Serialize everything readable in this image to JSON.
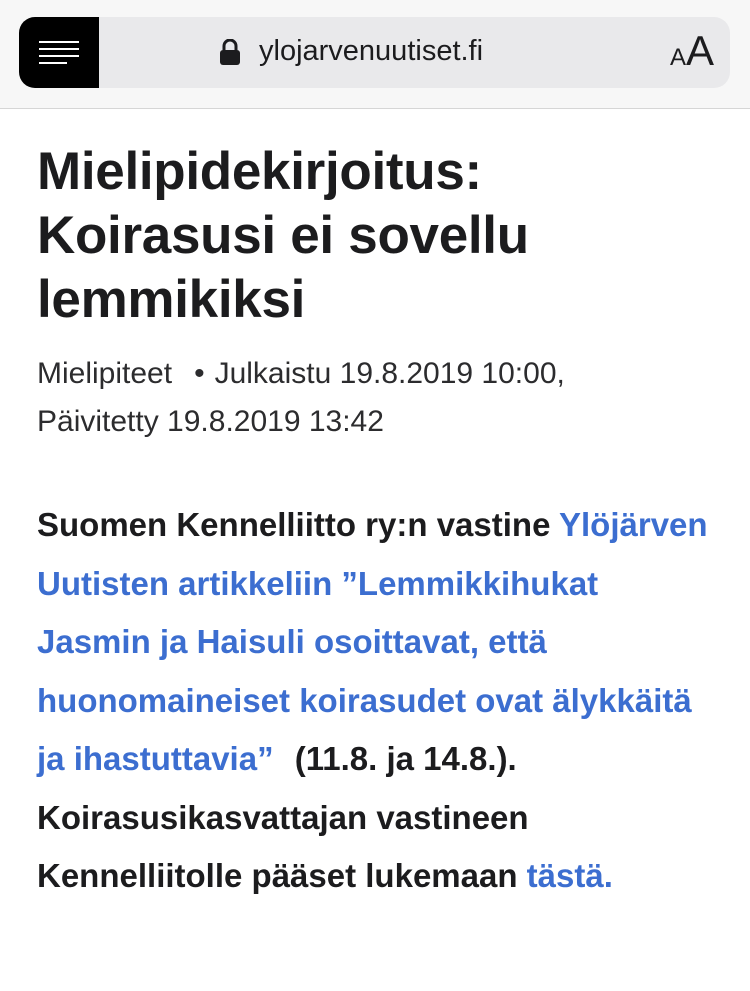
{
  "browser": {
    "url": "ylojarvenuutiset.fi",
    "text_size_small": "A",
    "text_size_big": "A"
  },
  "article": {
    "title": "Mielipidekirjoitus: Koirasusi ei sovellu lemmikiksi",
    "category": "Mielipiteet",
    "separator": "•",
    "published": "Julkaistu 19.8.2019 10:00,",
    "updated": "Päivitetty 19.8.2019 13:42",
    "intro": "Suomen Kennelliitto ry:n vastine",
    "link_text": "Ylöjärven Uutisten artikkeliin ”Lemmikkihukat Jasmin ja Haisuli osoittavat, että huonomaineiset koirasudet ovat älykkäitä ja ihastuttavia”",
    "dates": "(11.8. ja 14.8.).",
    "continuation": "Koirasusikasvattajan vastineen Kennelliitolle pääset lukemaan",
    "here_link": "tästä."
  },
  "colors": {
    "link": "#3c6ed0",
    "text": "#1c1c1e",
    "menu_button": "#000000"
  },
  "icons": [
    "menu-icon",
    "lock-icon",
    "text-size-icon"
  ]
}
